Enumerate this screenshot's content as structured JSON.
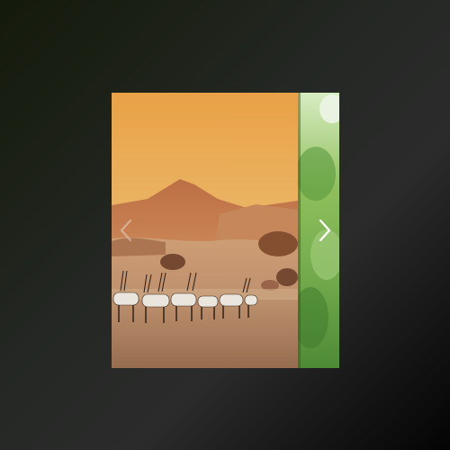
{
  "page": {
    "background_colors": [
      "#141a0b",
      "#2b2b2b",
      "#040404"
    ]
  },
  "carousel": {
    "slides": [
      {
        "name": "desert-oryx-slide",
        "palette": {
          "sky_top": "#f6b04a",
          "sky_bottom": "#f4cd82",
          "mountain": "#c4794a",
          "ground": "#c9a27c",
          "herd": "#f4efe6"
        }
      },
      {
        "name": "green-foliage-slide",
        "palette": {
          "leaf_light": "#b7d88d",
          "leaf_dark": "#3f7b2c"
        }
      }
    ],
    "prev_icon": "chevron-left-icon",
    "next_icon": "chevron-right-icon"
  }
}
